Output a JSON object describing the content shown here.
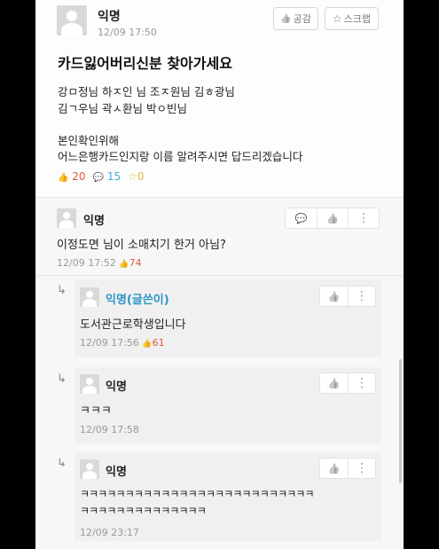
{
  "post": {
    "author": "익명",
    "time": "12/09 17:50",
    "like_button": "공감",
    "scrap_button": "스크랩",
    "title": "카드잃어버리신분 찾아가세요",
    "body_lines": [
      "강ㅁ정님 하ㅈ인 님 조ㅈ원님 김ㅎ광님",
      "김ㄱ우님 곽ㅅ환님 박ㅇ빈님",
      "본인확인위해",
      "어느은행카드인지랑 이름 알려주시면 답드리겠습니다"
    ],
    "likes": "20",
    "comments": "15",
    "scraps": "0"
  },
  "comments": [
    {
      "author": "익명",
      "text": "이정도면 님이 소매치기 한거 아님?",
      "time": "12/09 17:52",
      "likes": "74"
    }
  ],
  "replies": [
    {
      "author": "익명(글쓴이)",
      "text": "도서관근로학생입니다",
      "time": "12/09 17:56",
      "likes": "61"
    },
    {
      "author": "익명",
      "text": "ㅋㅋㅋ",
      "time": "12/09 17:58"
    },
    {
      "author": "익명",
      "text_line1": "ㅋㅋㅋㅋㅋㅋㅋㅋㅋㅋㅋㅋㅋㅋㅋㅋㅋㅋㅋㅋㅋㅋㅋㅋㅋㅋ",
      "text_line2": "ㅋㅋㅋㅋㅋㅋㅋㅋㅋㅋㅋㅋㅋㅋ",
      "time": "12/09 23:17"
    }
  ],
  "icons": {
    "thumb": "👍",
    "speech": "💬",
    "star": "☆",
    "dots": "⋮",
    "reply_arrow": "↳"
  },
  "colors": {
    "like_red": "#e0593f",
    "comment_blue": "#3fa9d6",
    "scrap_yellow": "#e0b63f",
    "op_blue": "#2d95c7"
  }
}
